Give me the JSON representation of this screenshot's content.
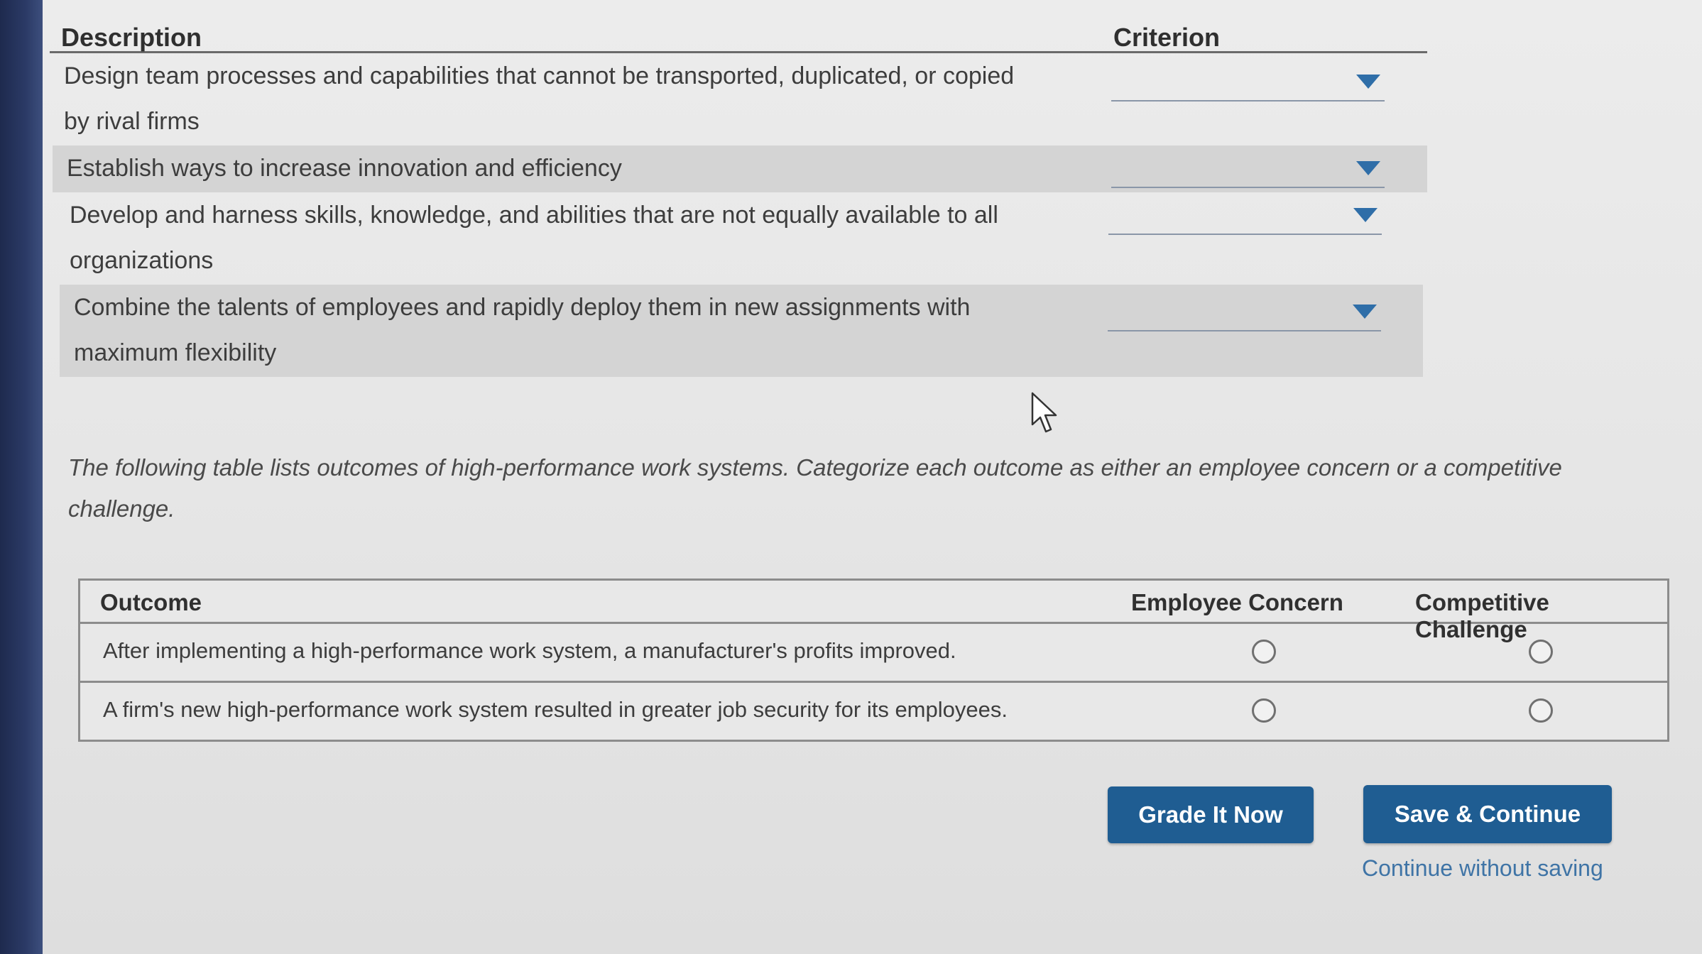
{
  "criterion_table": {
    "header_description": "Description",
    "header_criterion": "Criterion",
    "rows": [
      {
        "description_line1": "Design team processes and capabilities that cannot be transported, duplicated, or copied",
        "description_line2": "by rival firms",
        "selected": ""
      },
      {
        "description_line1": "Establish ways to increase innovation and efficiency",
        "description_line2": "",
        "selected": ""
      },
      {
        "description_line1": "Develop and harness skills, knowledge, and abilities that are not equally available to all",
        "description_line2": "organizations",
        "selected": ""
      },
      {
        "description_line1": "Combine the talents of employees and rapidly deploy them in new assignments with",
        "description_line2": "maximum flexibility",
        "selected": ""
      }
    ]
  },
  "instructions": "The following table lists outcomes of high-performance work systems. Categorize each outcome as either an employee concern or a competitive challenge.",
  "outcome_table": {
    "header_outcome": "Outcome",
    "header_employee": "Employee Concern",
    "header_competitive": "Competitive Challenge",
    "rows": [
      {
        "outcome": "After implementing a high-performance work system, a manufacturer's profits improved."
      },
      {
        "outcome": "A firm's new high-performance work system resulted in greater job security for its employees."
      }
    ]
  },
  "buttons": {
    "grade": "Grade It Now",
    "save": "Save & Continue",
    "continue_link": "Continue without saving"
  },
  "icons": {
    "dropdown": "chevron-down-icon",
    "cursor": "mouse-pointer-icon"
  },
  "colors": {
    "button_bg": "#1f5d92",
    "link": "#3f74a6",
    "dropdown_arrow": "#2f6ea8"
  }
}
